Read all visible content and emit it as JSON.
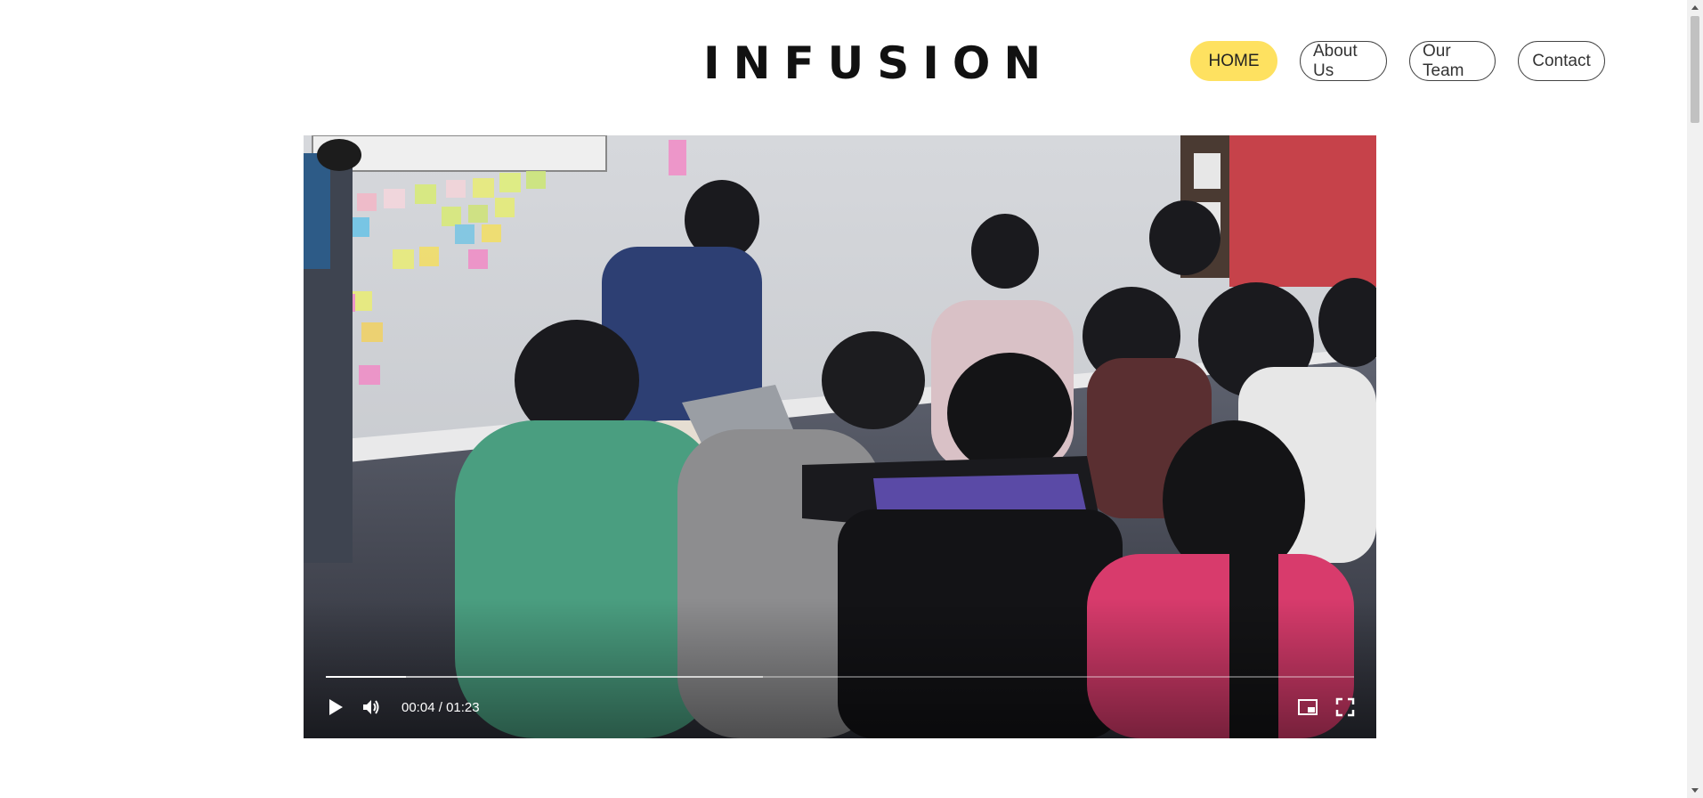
{
  "header": {
    "logo": "INFUSION",
    "nav": [
      {
        "label": "HOME",
        "active": true
      },
      {
        "label": "About Us",
        "active": false
      },
      {
        "label": "Our Team",
        "active": false
      },
      {
        "label": "Contact",
        "active": false
      }
    ]
  },
  "video": {
    "current_time": "00:04",
    "separator": "/",
    "duration": "01:23",
    "progress_fraction": 0.078,
    "icons": [
      "play-icon",
      "volume-icon",
      "picture-in-picture-icon",
      "fullscreen-icon"
    ]
  },
  "colors": {
    "accent": "#fee160",
    "nav_border": "#444444",
    "text": "#111111"
  }
}
